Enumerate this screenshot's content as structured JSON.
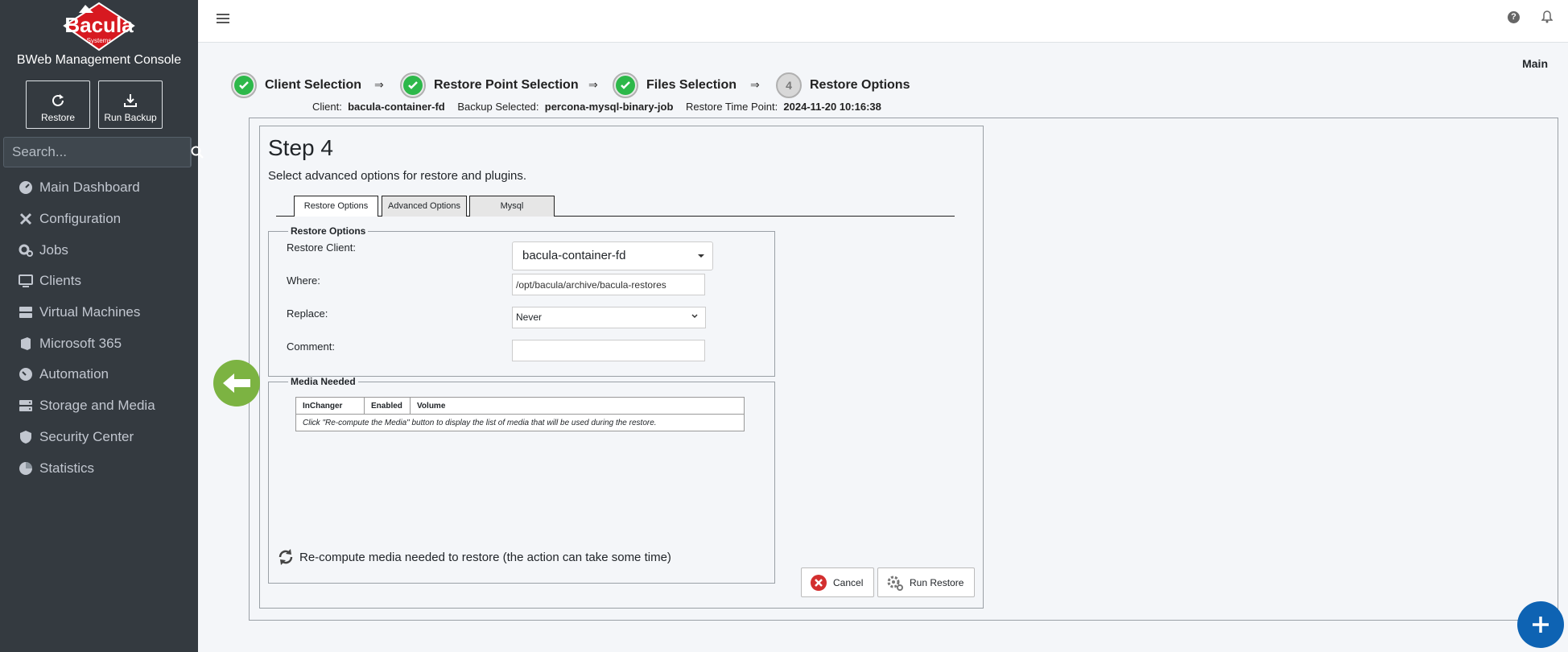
{
  "sidebar": {
    "logo_text": "Bacula",
    "logo_subtext": "Systems",
    "brand_title": "BWeb Management Console",
    "quick_actions": [
      {
        "label": "Restore",
        "icon": "refresh-icon"
      },
      {
        "label": "Run Backup",
        "icon": "download-icon"
      }
    ],
    "search": {
      "placeholder": "Search...",
      "value": ""
    },
    "nav": [
      {
        "label": "Main Dashboard",
        "icon": "dashboard-icon"
      },
      {
        "label": "Configuration",
        "icon": "tools-icon"
      },
      {
        "label": "Jobs",
        "icon": "cogs-icon"
      },
      {
        "label": "Clients",
        "icon": "desktop-icon"
      },
      {
        "label": "Virtual Machines",
        "icon": "server-icon"
      },
      {
        "label": "Microsoft 365",
        "icon": "office-icon"
      },
      {
        "label": "Automation",
        "icon": "gauge-icon"
      },
      {
        "label": "Storage and Media",
        "icon": "storage-icon"
      },
      {
        "label": "Security Center",
        "icon": "shield-icon"
      },
      {
        "label": "Statistics",
        "icon": "pie-chart-icon"
      }
    ]
  },
  "topbar": {
    "breadcrumb": "Main"
  },
  "wizard": {
    "steps": [
      {
        "label": "Client Selection",
        "state": "done"
      },
      {
        "label": "Restore Point Selection",
        "state": "done"
      },
      {
        "label": "Files Selection",
        "state": "done"
      },
      {
        "label": "Restore Options",
        "state": "current",
        "number": "4"
      }
    ],
    "arrow": "⇒",
    "summary": {
      "client_label": "Client:",
      "client_value": "bacula-container-fd",
      "backup_label": "Backup Selected:",
      "backup_value": "percona-mysql-binary-job",
      "time_label": "Restore Time Point:",
      "time_value": "2024-11-20 10:16:38"
    }
  },
  "step": {
    "title": "Step 4",
    "subtitle": "Select advanced options for restore and plugins."
  },
  "tabs": [
    {
      "label": "Restore Options",
      "active": true
    },
    {
      "label": "Advanced Options",
      "active": false
    },
    {
      "label": "Mysql",
      "active": false
    }
  ],
  "restore_options": {
    "legend": "Restore Options",
    "restore_client_label": "Restore Client:",
    "restore_client_value": "bacula-container-fd",
    "where_label": "Where:",
    "where_value": "/opt/bacula/archive/bacula-restores",
    "replace_label": "Replace:",
    "replace_value": "Never",
    "comment_label": "Comment:",
    "comment_value": ""
  },
  "media_needed": {
    "legend": "Media Needed",
    "columns": [
      "InChanger",
      "Enabled",
      "Volume"
    ],
    "empty_message": "Click \"Re-compute the Media\" button to display the list of media that will be used during the restore.",
    "recompute_label": "Re-compute media needed to restore (the action can take some time)"
  },
  "actions": {
    "cancel_label": "Cancel",
    "run_label": "Run Restore"
  },
  "colors": {
    "sidebar_bg": "#343a40",
    "success": "#2db84a",
    "back_button": "#7cb342",
    "fab": "#0e63b3",
    "cancel_icon": "#d32f2f"
  }
}
